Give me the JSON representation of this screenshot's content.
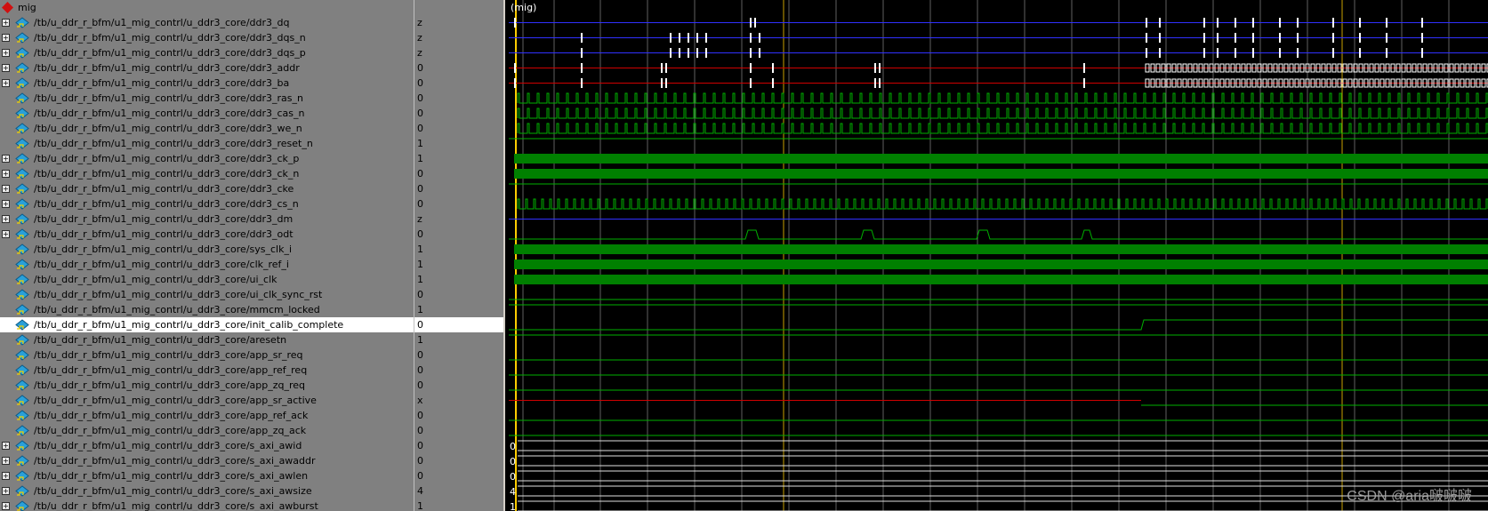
{
  "group": {
    "label": "mig",
    "wave_label": "(mig)"
  },
  "signals": [
    {
      "name": "/tb/u_ddr_r_bfm/u1_mig_contrl/u_ddr3_core/ddr3_dq",
      "value": "z",
      "bus": true
    },
    {
      "name": "/tb/u_ddr_r_bfm/u1_mig_contrl/u_ddr3_core/ddr3_dqs_n",
      "value": "z",
      "bus": true
    },
    {
      "name": "/tb/u_ddr_r_bfm/u1_mig_contrl/u_ddr3_core/ddr3_dqs_p",
      "value": "z",
      "bus": true
    },
    {
      "name": "/tb/u_ddr_r_bfm/u1_mig_contrl/u_ddr3_core/ddr3_addr",
      "value": "0",
      "bus": true
    },
    {
      "name": "/tb/u_ddr_r_bfm/u1_mig_contrl/u_ddr3_core/ddr3_ba",
      "value": "0",
      "bus": true
    },
    {
      "name": "/tb/u_ddr_r_bfm/u1_mig_contrl/u_ddr3_core/ddr3_ras_n",
      "value": "0",
      "bus": false
    },
    {
      "name": "/tb/u_ddr_r_bfm/u1_mig_contrl/u_ddr3_core/ddr3_cas_n",
      "value": "0",
      "bus": false
    },
    {
      "name": "/tb/u_ddr_r_bfm/u1_mig_contrl/u_ddr3_core/ddr3_we_n",
      "value": "0",
      "bus": false
    },
    {
      "name": "/tb/u_ddr_r_bfm/u1_mig_contrl/u_ddr3_core/ddr3_reset_n",
      "value": "1",
      "bus": false
    },
    {
      "name": "/tb/u_ddr_r_bfm/u1_mig_contrl/u_ddr3_core/ddr3_ck_p",
      "value": "1",
      "bus": true
    },
    {
      "name": "/tb/u_ddr_r_bfm/u1_mig_contrl/u_ddr3_core/ddr3_ck_n",
      "value": "0",
      "bus": true
    },
    {
      "name": "/tb/u_ddr_r_bfm/u1_mig_contrl/u_ddr3_core/ddr3_cke",
      "value": "0",
      "bus": true
    },
    {
      "name": "/tb/u_ddr_r_bfm/u1_mig_contrl/u_ddr3_core/ddr3_cs_n",
      "value": "0",
      "bus": true
    },
    {
      "name": "/tb/u_ddr_r_bfm/u1_mig_contrl/u_ddr3_core/ddr3_dm",
      "value": "z",
      "bus": true
    },
    {
      "name": "/tb/u_ddr_r_bfm/u1_mig_contrl/u_ddr3_core/ddr3_odt",
      "value": "0",
      "bus": true
    },
    {
      "name": "/tb/u_ddr_r_bfm/u1_mig_contrl/u_ddr3_core/sys_clk_i",
      "value": "1",
      "bus": false
    },
    {
      "name": "/tb/u_ddr_r_bfm/u1_mig_contrl/u_ddr3_core/clk_ref_i",
      "value": "1",
      "bus": false
    },
    {
      "name": "/tb/u_ddr_r_bfm/u1_mig_contrl/u_ddr3_core/ui_clk",
      "value": "1",
      "bus": false
    },
    {
      "name": "/tb/u_ddr_r_bfm/u1_mig_contrl/u_ddr3_core/ui_clk_sync_rst",
      "value": "0",
      "bus": false
    },
    {
      "name": "/tb/u_ddr_r_bfm/u1_mig_contrl/u_ddr3_core/mmcm_locked",
      "value": "1",
      "bus": false
    },
    {
      "name": "/tb/u_ddr_r_bfm/u1_mig_contrl/u_ddr3_core/init_calib_complete",
      "value": "0",
      "bus": false,
      "selected": true
    },
    {
      "name": "/tb/u_ddr_r_bfm/u1_mig_contrl/u_ddr3_core/aresetn",
      "value": "1",
      "bus": false
    },
    {
      "name": "/tb/u_ddr_r_bfm/u1_mig_contrl/u_ddr3_core/app_sr_req",
      "value": "0",
      "bus": false
    },
    {
      "name": "/tb/u_ddr_r_bfm/u1_mig_contrl/u_ddr3_core/app_ref_req",
      "value": "0",
      "bus": false
    },
    {
      "name": "/tb/u_ddr_r_bfm/u1_mig_contrl/u_ddr3_core/app_zq_req",
      "value": "0",
      "bus": false
    },
    {
      "name": "/tb/u_ddr_r_bfm/u1_mig_contrl/u_ddr3_core/app_sr_active",
      "value": "x",
      "bus": false
    },
    {
      "name": "/tb/u_ddr_r_bfm/u1_mig_contrl/u_ddr3_core/app_ref_ack",
      "value": "0",
      "bus": false
    },
    {
      "name": "/tb/u_ddr_r_bfm/u1_mig_contrl/u_ddr3_core/app_zq_ack",
      "value": "0",
      "bus": false
    },
    {
      "name": "/tb/u_ddr_r_bfm/u1_mig_contrl/u_ddr3_core/s_axi_awid",
      "value": "0",
      "bus": true
    },
    {
      "name": "/tb/u_ddr_r_bfm/u1_mig_contrl/u_ddr3_core/s_axi_awaddr",
      "value": "0",
      "bus": true
    },
    {
      "name": "/tb/u_ddr_r_bfm/u1_mig_contrl/u_ddr3_core/s_axi_awlen",
      "value": "0",
      "bus": true
    },
    {
      "name": "/tb/u_ddr_r_bfm/u1_mig_contrl/u_ddr3_core/s_axi_awsize",
      "value": "4",
      "bus": true
    },
    {
      "name": "/tb/u_ddr_r_bfm/u1_mig_contrl/u_ddr3_core/s_axi_awburst",
      "value": "1",
      "bus": true
    }
  ],
  "bus_wave_labels": [
    "0",
    "0",
    "0",
    "4",
    "1"
  ],
  "watermark": "CSDN @aria啵啵啵",
  "colors": {
    "wave_green": "#00b000",
    "wave_blue": "#3030ff",
    "wave_red": "#d00000",
    "bus_white": "#e0e0e0",
    "cursor_yellow": "#ffcc00",
    "grid": "#606060",
    "selection": "#ffffff",
    "pane_bg": "#808080"
  }
}
